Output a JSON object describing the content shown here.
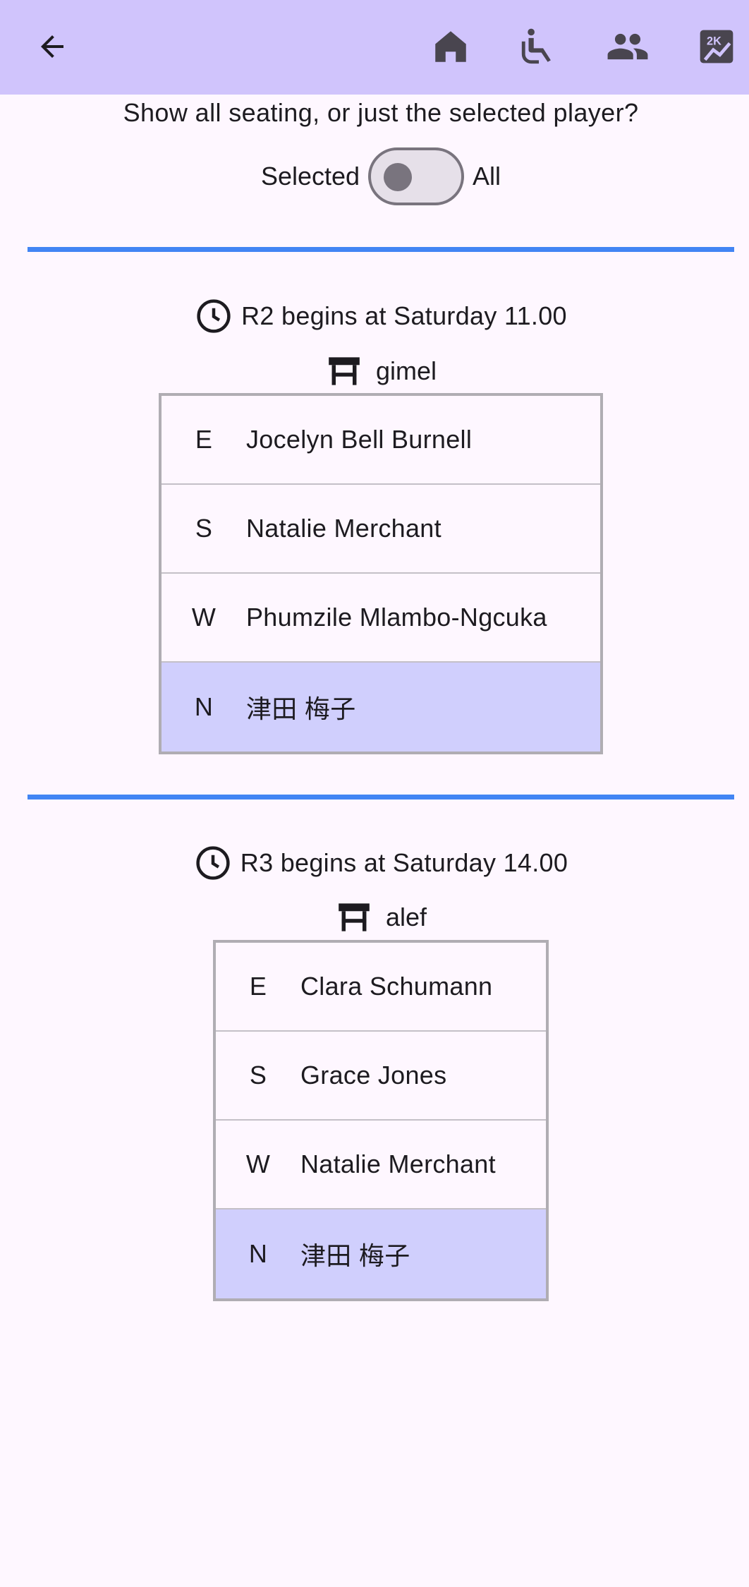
{
  "appbar": {
    "back_icon": "arrow-left-icon",
    "actions": [
      {
        "icon": "home-icon"
      },
      {
        "icon": "seat-icon"
      },
      {
        "icon": "people-icon"
      },
      {
        "icon": "scores-icon"
      }
    ]
  },
  "prompt": "Show all seating, or just the selected player?",
  "toggle": {
    "left_label": "Selected",
    "right_label": "All",
    "state": "off"
  },
  "rounds": [
    {
      "time_text": "R2 begins at Saturday 11.00",
      "table_name": "gimel",
      "seats": [
        {
          "dir": "E",
          "name": "Jocelyn Bell Burnell",
          "highlighted": false
        },
        {
          "dir": "S",
          "name": "Natalie Merchant",
          "highlighted": false
        },
        {
          "dir": "W",
          "name": "Phumzile Mlambo-Ngcuka",
          "highlighted": false
        },
        {
          "dir": "N",
          "name": "津田 梅子",
          "highlighted": true
        }
      ]
    },
    {
      "time_text": "R3 begins at Saturday 14.00",
      "table_name": "alef",
      "seats": [
        {
          "dir": "E",
          "name": "Clara Schumann",
          "highlighted": false
        },
        {
          "dir": "S",
          "name": "Grace Jones",
          "highlighted": false
        },
        {
          "dir": "W",
          "name": "Natalie Merchant",
          "highlighted": false
        },
        {
          "dir": "N",
          "name": "津田 梅子",
          "highlighted": true
        }
      ]
    }
  ],
  "colors": {
    "appbar": "#d0c4fc",
    "divider": "#4285f4",
    "highlight_row": "#d0cffd",
    "background": "#fef7ff"
  }
}
